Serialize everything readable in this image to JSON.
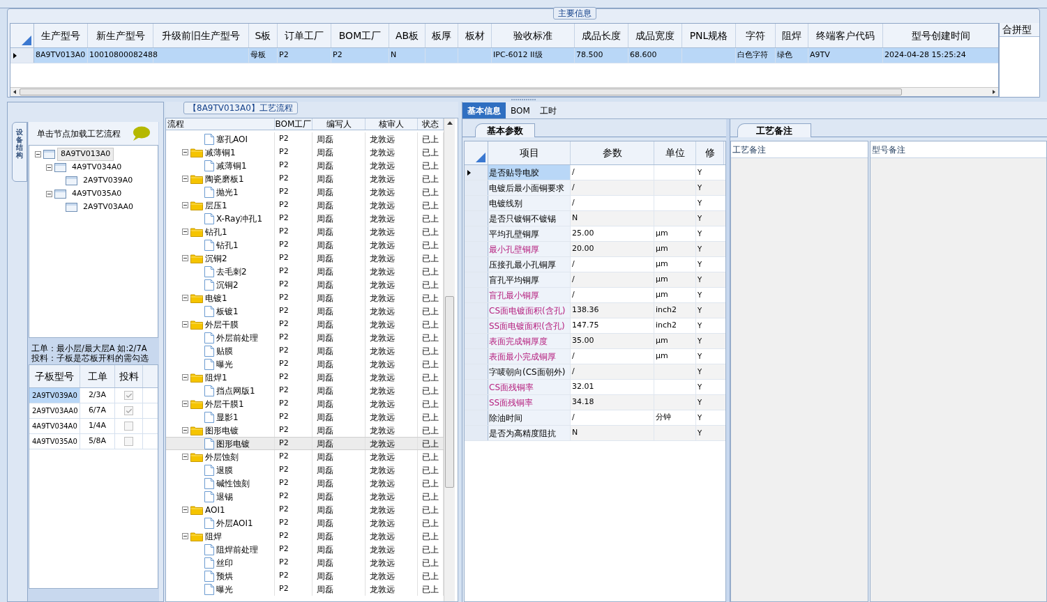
{
  "main_info": {
    "legend": "主要信息",
    "columns": [
      "生产型号",
      "新生产型号",
      "升级前旧生产型号",
      "S板",
      "订单工厂",
      "BOM工厂",
      "AB板",
      "板厚",
      "板材",
      "验收标准",
      "成品长度",
      "成品宽度",
      "PNL规格",
      "字符",
      "阻焊",
      "终端客户代码",
      "型号创建时间"
    ],
    "rows": [
      {
        "selected": true,
        "cells": [
          "8A9TV013A0",
          "10010800082488",
          "",
          "母板",
          "P2",
          "P2",
          "N",
          "",
          "",
          "IPC-6012 II级",
          "78.500",
          "68.600",
          "",
          "白色字符",
          "绿色",
          "A9TV",
          "2024-04-28 15:25:24"
        ]
      }
    ],
    "side_header": "合拼型"
  },
  "structure": {
    "tab": "设备结构",
    "hint": "单击节点加载工艺流程",
    "tree": [
      {
        "label": "8A9TV013A0",
        "selected": true,
        "expanded": true,
        "children": [
          {
            "label": "4A9TV034A0",
            "selected": false,
            "expanded": true,
            "children": [
              {
                "label": "2A9TV039A0",
                "selected": false
              }
            ]
          },
          {
            "label": "4A9TV035A0",
            "selected": false,
            "expanded": true,
            "children": [
              {
                "label": "2A9TV03AA0",
                "selected": false
              }
            ]
          }
        ]
      }
    ],
    "note_lines": [
      "工单：最小层/最大层A 如:2/7A",
      "投料：子板是芯板开料的需勾选"
    ],
    "sub_columns": [
      "子板型号",
      "工单",
      "投料"
    ],
    "sub_rows": [
      {
        "model": "2A9TV039A0",
        "order": "2/3A",
        "checked": true,
        "selected": true
      },
      {
        "model": "2A9TV03AA0",
        "order": "6/7A",
        "checked": true,
        "selected": false
      },
      {
        "model": "4A9TV034A0",
        "order": "1/4A",
        "checked": false,
        "selected": false
      },
      {
        "model": "4A9TV035A0",
        "order": "5/8A",
        "checked": false,
        "selected": false
      }
    ]
  },
  "process": {
    "legend": "【8A9TV013A0】工艺流程",
    "columns": [
      "流程",
      "BOM工厂",
      "编写人",
      "核审人",
      "状态"
    ],
    "steps": [
      {
        "children": [
          {
            "name": "塞孔AOI",
            "bom": "P2",
            "writer": "周磊",
            "reviewer": "龙敦远",
            "status": "已上",
            "selected": false
          }
        ]
      },
      {
        "name": "减薄铜1",
        "bom": "P2",
        "writer": "周磊",
        "reviewer": "龙敦远",
        "status": "已上",
        "selected": false,
        "expanded": true,
        "children": [
          {
            "name": "减薄铜1",
            "bom": "P2",
            "writer": "周磊",
            "reviewer": "龙敦远",
            "status": "已上",
            "selected": false
          }
        ]
      },
      {
        "name": "陶瓷磨板1",
        "bom": "P2",
        "writer": "周磊",
        "reviewer": "龙敦远",
        "status": "已上",
        "selected": false,
        "expanded": true,
        "children": [
          {
            "name": "抛光1",
            "bom": "P2",
            "writer": "周磊",
            "reviewer": "龙敦远",
            "status": "已上",
            "selected": false
          }
        ]
      },
      {
        "name": "层压1",
        "bom": "P2",
        "writer": "周磊",
        "reviewer": "龙敦远",
        "status": "已上",
        "selected": false,
        "expanded": true,
        "children": [
          {
            "name": "X-Ray冲孔1",
            "bom": "P2",
            "writer": "周磊",
            "reviewer": "龙敦远",
            "status": "已上",
            "selected": false
          }
        ]
      },
      {
        "name": "钻孔1",
        "bom": "P2",
        "writer": "周磊",
        "reviewer": "龙敦远",
        "status": "已上",
        "selected": false,
        "expanded": true,
        "children": [
          {
            "name": "钻孔1",
            "bom": "P2",
            "writer": "周磊",
            "reviewer": "龙敦远",
            "status": "已上",
            "selected": false
          }
        ]
      },
      {
        "name": "沉铜2",
        "bom": "P2",
        "writer": "周磊",
        "reviewer": "龙敦远",
        "status": "已上",
        "selected": false,
        "expanded": true,
        "children": [
          {
            "name": "去毛刺2",
            "bom": "P2",
            "writer": "周磊",
            "reviewer": "龙敦远",
            "status": "已上",
            "selected": false
          },
          {
            "name": "沉铜2",
            "bom": "P2",
            "writer": "周磊",
            "reviewer": "龙敦远",
            "status": "已上",
            "selected": false
          }
        ]
      },
      {
        "name": "电镀1",
        "bom": "P2",
        "writer": "周磊",
        "reviewer": "龙敦远",
        "status": "已上",
        "selected": false,
        "expanded": true,
        "children": [
          {
            "name": "板镀1",
            "bom": "P2",
            "writer": "周磊",
            "reviewer": "龙敦远",
            "status": "已上",
            "selected": false
          }
        ]
      },
      {
        "name": "外层干膜",
        "bom": "P2",
        "writer": "周磊",
        "reviewer": "龙敦远",
        "status": "已上",
        "selected": false,
        "expanded": true,
        "children": [
          {
            "name": "外层前处理",
            "bom": "P2",
            "writer": "周磊",
            "reviewer": "龙敦远",
            "status": "已上",
            "selected": false
          },
          {
            "name": "贴膜",
            "bom": "P2",
            "writer": "周磊",
            "reviewer": "龙敦远",
            "status": "已上",
            "selected": false
          },
          {
            "name": "曝光",
            "bom": "P2",
            "writer": "周磊",
            "reviewer": "龙敦远",
            "status": "已上",
            "selected": false
          }
        ]
      },
      {
        "name": "阻焊1",
        "bom": "P2",
        "writer": "周磊",
        "reviewer": "龙敦远",
        "status": "已上",
        "selected": false,
        "expanded": true,
        "children": [
          {
            "name": "挡点网版1",
            "bom": "P2",
            "writer": "周磊",
            "reviewer": "龙敦远",
            "status": "已上",
            "selected": false
          }
        ]
      },
      {
        "name": "外层干膜1",
        "bom": "P2",
        "writer": "周磊",
        "reviewer": "龙敦远",
        "status": "已上",
        "selected": false,
        "expanded": true,
        "children": [
          {
            "name": "显影1",
            "bom": "P2",
            "writer": "周磊",
            "reviewer": "龙敦远",
            "status": "已上",
            "selected": false
          }
        ]
      },
      {
        "name": "图形电镀",
        "bom": "P2",
        "writer": "周磊",
        "reviewer": "龙敦远",
        "status": "已上",
        "selected": false,
        "expanded": true,
        "children": [
          {
            "name": "图形电镀",
            "bom": "P2",
            "writer": "周磊",
            "reviewer": "龙敦远",
            "status": "已上",
            "selected": true
          }
        ]
      },
      {
        "name": "外层蚀刻",
        "bom": "P2",
        "writer": "周磊",
        "reviewer": "龙敦远",
        "status": "已上",
        "selected": false,
        "expanded": true,
        "children": [
          {
            "name": "退膜",
            "bom": "P2",
            "writer": "周磊",
            "reviewer": "龙敦远",
            "status": "已上",
            "selected": false
          },
          {
            "name": "碱性蚀刻",
            "bom": "P2",
            "writer": "周磊",
            "reviewer": "龙敦远",
            "status": "已上",
            "selected": false
          },
          {
            "name": "退锡",
            "bom": "P2",
            "writer": "周磊",
            "reviewer": "龙敦远",
            "status": "已上",
            "selected": false
          }
        ]
      },
      {
        "name": "AOI1",
        "bom": "P2",
        "writer": "周磊",
        "reviewer": "龙敦远",
        "status": "已上",
        "selected": false,
        "expanded": true,
        "children": [
          {
            "name": "外层AOI1",
            "bom": "P2",
            "writer": "周磊",
            "reviewer": "龙敦远",
            "status": "已上",
            "selected": false
          }
        ]
      },
      {
        "name": "阻焊",
        "bom": "P2",
        "writer": "周磊",
        "reviewer": "龙敦远",
        "status": "已上",
        "selected": false,
        "expanded": true,
        "children": [
          {
            "name": "阻焊前处理",
            "bom": "P2",
            "writer": "周磊",
            "reviewer": "龙敦远",
            "status": "已上",
            "selected": false
          },
          {
            "name": "丝印",
            "bom": "P2",
            "writer": "周磊",
            "reviewer": "龙敦远",
            "status": "已上",
            "selected": false
          },
          {
            "name": "预烘",
            "bom": "P2",
            "writer": "周磊",
            "reviewer": "龙敦远",
            "status": "已上",
            "selected": false
          },
          {
            "name": "曝光",
            "bom": "P2",
            "writer": "周磊",
            "reviewer": "龙敦远",
            "status": "已上",
            "selected": false
          }
        ]
      }
    ]
  },
  "detail": {
    "tabs": [
      {
        "label": "基本信息",
        "selected": true
      },
      {
        "label": "BOM",
        "selected": false
      },
      {
        "label": "工时",
        "selected": false
      }
    ],
    "sub_tab": "基本参数",
    "columns": [
      "项目",
      "参数",
      "单位",
      "修"
    ],
    "rows": [
      {
        "item": "是否贴导电胶",
        "value": "/",
        "mod": "Y",
        "highlighted": false,
        "selected": true
      },
      {
        "item": "电镀后最小面铜要求",
        "value": "/",
        "mod": "Y",
        "highlighted": false,
        "selected": false
      },
      {
        "item": "电镀线别",
        "value": "/",
        "mod": "Y",
        "highlighted": false,
        "selected": false
      },
      {
        "item": "是否只镀铜不镀锡",
        "value": "N",
        "mod": "Y",
        "highlighted": false,
        "selected": false
      },
      {
        "item": "平均孔壁铜厚",
        "value": "25.00",
        "unit": "μm",
        "mod": "Y",
        "highlighted": false,
        "selected": false
      },
      {
        "item": "最小孔壁铜厚",
        "value": "20.00",
        "unit": "μm",
        "mod": "Y",
        "highlighted": true,
        "selected": false
      },
      {
        "item": "压接孔最小孔铜厚",
        "value": "/",
        "unit": "μm",
        "mod": "Y",
        "highlighted": false,
        "selected": false
      },
      {
        "item": "盲孔平均铜厚",
        "value": "/",
        "unit": "μm",
        "mod": "Y",
        "highlighted": false,
        "selected": false
      },
      {
        "item": "盲孔最小铜厚",
        "value": "/",
        "unit": "μm",
        "mod": "Y",
        "highlighted": true,
        "selected": false
      },
      {
        "item": "CS面电镀面积(含孔)",
        "value": "138.36",
        "unit": "inch2",
        "mod": "Y",
        "highlighted": true,
        "selected": false
      },
      {
        "item": "SS面电镀面积(含孔)",
        "value": "147.75",
        "unit": "inch2",
        "mod": "Y",
        "highlighted": true,
        "selected": false
      },
      {
        "item": "表面完成铜厚度",
        "value": "35.00",
        "unit": "μm",
        "mod": "Y",
        "highlighted": true,
        "selected": false
      },
      {
        "item": "表面最小完成铜厚",
        "value": "/",
        "unit": "μm",
        "mod": "Y",
        "highlighted": true,
        "selected": false
      },
      {
        "item": "字唛朝向(CS面朝外)",
        "value": "/",
        "mod": "Y",
        "highlighted": false,
        "selected": false
      },
      {
        "item": "CS面残铜率",
        "value": "32.01",
        "mod": "Y",
        "highlighted": true,
        "selected": false
      },
      {
        "item": "SS面残铜率",
        "value": "34.18",
        "mod": "Y",
        "highlighted": true,
        "selected": false
      },
      {
        "item": "除油时间",
        "value": "/",
        "unit": "分钟",
        "mod": "Y",
        "highlighted": false,
        "selected": false
      },
      {
        "item": "是否为高精度阻抗",
        "value": "N",
        "mod": "Y",
        "highlighted": false,
        "selected": false
      }
    ]
  },
  "remarks": {
    "tab": "工艺备注",
    "panels": [
      "工艺备注",
      "型号备注"
    ]
  }
}
